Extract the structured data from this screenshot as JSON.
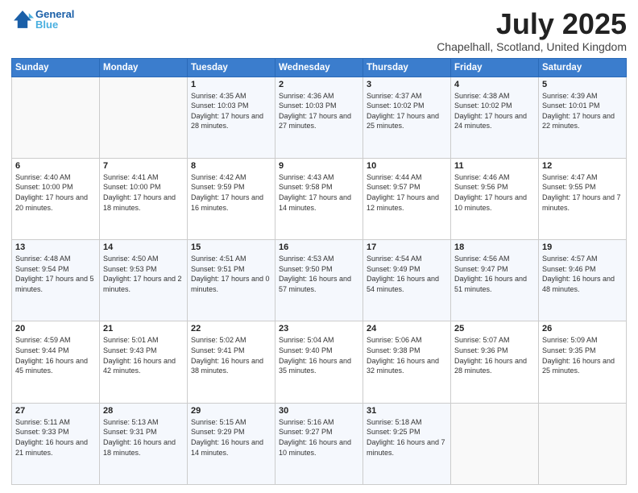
{
  "logo": {
    "line1": "General",
    "line2": "Blue"
  },
  "title": "July 2025",
  "subtitle": "Chapelhall, Scotland, United Kingdom",
  "days_of_week": [
    "Sunday",
    "Monday",
    "Tuesday",
    "Wednesday",
    "Thursday",
    "Friday",
    "Saturday"
  ],
  "weeks": [
    [
      {
        "day": "",
        "info": ""
      },
      {
        "day": "",
        "info": ""
      },
      {
        "day": "1",
        "info": "Sunrise: 4:35 AM\nSunset: 10:03 PM\nDaylight: 17 hours and 28 minutes."
      },
      {
        "day": "2",
        "info": "Sunrise: 4:36 AM\nSunset: 10:03 PM\nDaylight: 17 hours and 27 minutes."
      },
      {
        "day": "3",
        "info": "Sunrise: 4:37 AM\nSunset: 10:02 PM\nDaylight: 17 hours and 25 minutes."
      },
      {
        "day": "4",
        "info": "Sunrise: 4:38 AM\nSunset: 10:02 PM\nDaylight: 17 hours and 24 minutes."
      },
      {
        "day": "5",
        "info": "Sunrise: 4:39 AM\nSunset: 10:01 PM\nDaylight: 17 hours and 22 minutes."
      }
    ],
    [
      {
        "day": "6",
        "info": "Sunrise: 4:40 AM\nSunset: 10:00 PM\nDaylight: 17 hours and 20 minutes."
      },
      {
        "day": "7",
        "info": "Sunrise: 4:41 AM\nSunset: 10:00 PM\nDaylight: 17 hours and 18 minutes."
      },
      {
        "day": "8",
        "info": "Sunrise: 4:42 AM\nSunset: 9:59 PM\nDaylight: 17 hours and 16 minutes."
      },
      {
        "day": "9",
        "info": "Sunrise: 4:43 AM\nSunset: 9:58 PM\nDaylight: 17 hours and 14 minutes."
      },
      {
        "day": "10",
        "info": "Sunrise: 4:44 AM\nSunset: 9:57 PM\nDaylight: 17 hours and 12 minutes."
      },
      {
        "day": "11",
        "info": "Sunrise: 4:46 AM\nSunset: 9:56 PM\nDaylight: 17 hours and 10 minutes."
      },
      {
        "day": "12",
        "info": "Sunrise: 4:47 AM\nSunset: 9:55 PM\nDaylight: 17 hours and 7 minutes."
      }
    ],
    [
      {
        "day": "13",
        "info": "Sunrise: 4:48 AM\nSunset: 9:54 PM\nDaylight: 17 hours and 5 minutes."
      },
      {
        "day": "14",
        "info": "Sunrise: 4:50 AM\nSunset: 9:53 PM\nDaylight: 17 hours and 2 minutes."
      },
      {
        "day": "15",
        "info": "Sunrise: 4:51 AM\nSunset: 9:51 PM\nDaylight: 17 hours and 0 minutes."
      },
      {
        "day": "16",
        "info": "Sunrise: 4:53 AM\nSunset: 9:50 PM\nDaylight: 16 hours and 57 minutes."
      },
      {
        "day": "17",
        "info": "Sunrise: 4:54 AM\nSunset: 9:49 PM\nDaylight: 16 hours and 54 minutes."
      },
      {
        "day": "18",
        "info": "Sunrise: 4:56 AM\nSunset: 9:47 PM\nDaylight: 16 hours and 51 minutes."
      },
      {
        "day": "19",
        "info": "Sunrise: 4:57 AM\nSunset: 9:46 PM\nDaylight: 16 hours and 48 minutes."
      }
    ],
    [
      {
        "day": "20",
        "info": "Sunrise: 4:59 AM\nSunset: 9:44 PM\nDaylight: 16 hours and 45 minutes."
      },
      {
        "day": "21",
        "info": "Sunrise: 5:01 AM\nSunset: 9:43 PM\nDaylight: 16 hours and 42 minutes."
      },
      {
        "day": "22",
        "info": "Sunrise: 5:02 AM\nSunset: 9:41 PM\nDaylight: 16 hours and 38 minutes."
      },
      {
        "day": "23",
        "info": "Sunrise: 5:04 AM\nSunset: 9:40 PM\nDaylight: 16 hours and 35 minutes."
      },
      {
        "day": "24",
        "info": "Sunrise: 5:06 AM\nSunset: 9:38 PM\nDaylight: 16 hours and 32 minutes."
      },
      {
        "day": "25",
        "info": "Sunrise: 5:07 AM\nSunset: 9:36 PM\nDaylight: 16 hours and 28 minutes."
      },
      {
        "day": "26",
        "info": "Sunrise: 5:09 AM\nSunset: 9:35 PM\nDaylight: 16 hours and 25 minutes."
      }
    ],
    [
      {
        "day": "27",
        "info": "Sunrise: 5:11 AM\nSunset: 9:33 PM\nDaylight: 16 hours and 21 minutes."
      },
      {
        "day": "28",
        "info": "Sunrise: 5:13 AM\nSunset: 9:31 PM\nDaylight: 16 hours and 18 minutes."
      },
      {
        "day": "29",
        "info": "Sunrise: 5:15 AM\nSunset: 9:29 PM\nDaylight: 16 hours and 14 minutes."
      },
      {
        "day": "30",
        "info": "Sunrise: 5:16 AM\nSunset: 9:27 PM\nDaylight: 16 hours and 10 minutes."
      },
      {
        "day": "31",
        "info": "Sunrise: 5:18 AM\nSunset: 9:25 PM\nDaylight: 16 hours and 7 minutes."
      },
      {
        "day": "",
        "info": ""
      },
      {
        "day": "",
        "info": ""
      }
    ]
  ]
}
